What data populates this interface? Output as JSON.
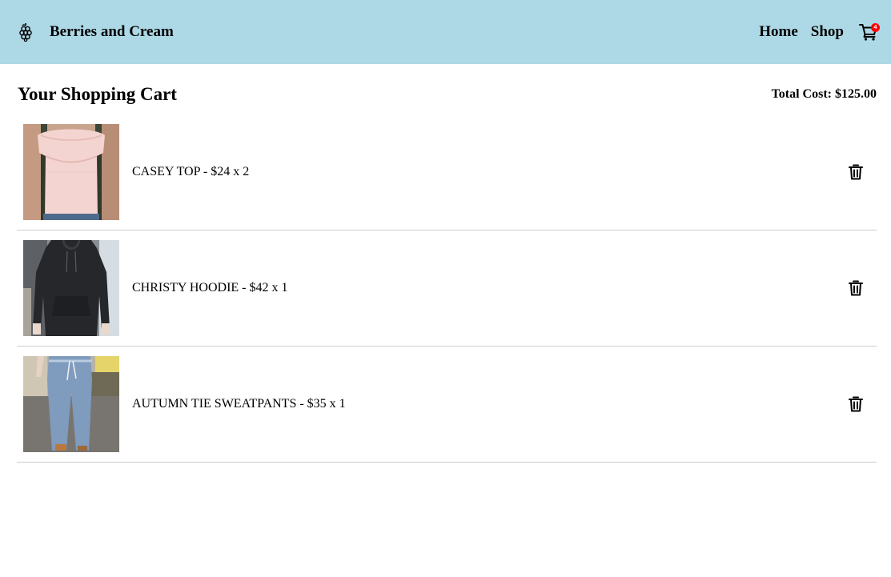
{
  "colors": {
    "header_bg": "#add8e6",
    "badge_bg": "#ff0000",
    "divider": "#cccccc"
  },
  "header": {
    "brand_name": "Berries and Cream",
    "brand_icon": "berry-icon",
    "nav": [
      {
        "label": "Home"
      },
      {
        "label": "Shop"
      }
    ],
    "cart_icon": "cart-icon",
    "cart_count": "4"
  },
  "cart": {
    "title": "Your Shopping Cart",
    "total_label": "Total Cost: $125.00",
    "items": [
      {
        "text": "CASEY TOP - $24 x 2",
        "image": "pink-top-photo",
        "remove_icon": "trash-icon"
      },
      {
        "text": "CHRISTY HOODIE - $42 x 1",
        "image": "black-hoodie-photo",
        "remove_icon": "trash-icon"
      },
      {
        "text": "AUTUMN TIE SWEATPANTS - $35 x 1",
        "image": "grey-sweatpants-photo",
        "remove_icon": "trash-icon"
      }
    ]
  }
}
